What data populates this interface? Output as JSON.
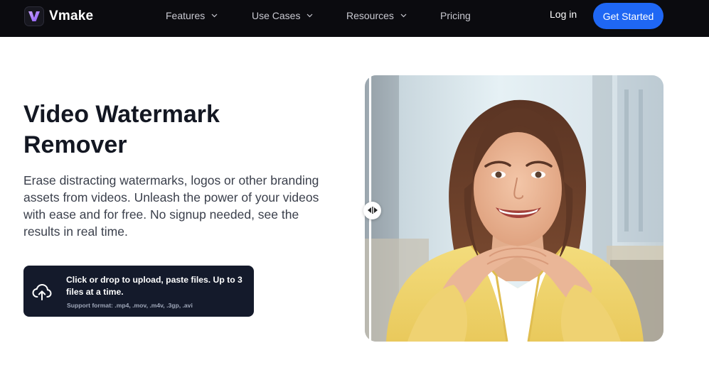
{
  "header": {
    "brand": "Vmake",
    "nav": [
      {
        "label": "Features",
        "has_dropdown": true
      },
      {
        "label": "Use Cases",
        "has_dropdown": true
      },
      {
        "label": "Resources",
        "has_dropdown": true
      },
      {
        "label": "Pricing",
        "has_dropdown": false
      }
    ],
    "login_label": "Log in",
    "cta_label": "Get Started"
  },
  "hero": {
    "title_line1": "Video Watermark",
    "title_line2": "Remover",
    "description": "Erase distracting watermarks, logos or other branding assets from videos. Unleash the power of your videos with ease and for free. No signup needed, see the results in real time."
  },
  "upload": {
    "main_text": "Click or drop to upload, paste files. Up to 3 files at a time.",
    "formats_text": "Support format: .mp4, .mov, .m4v, .3gp, .avi",
    "icon": "upload-cloud-icon"
  },
  "preview": {
    "image": "smiling-woman-yellow-cardigan",
    "handle_icon": "compare-arrows-icon"
  },
  "colors": {
    "header_bg": "#0b0b0f",
    "cta_bg": "#1f67f4",
    "upload_bg": "#141a2b",
    "title": "#131722",
    "body_text": "#3a3f4b"
  }
}
